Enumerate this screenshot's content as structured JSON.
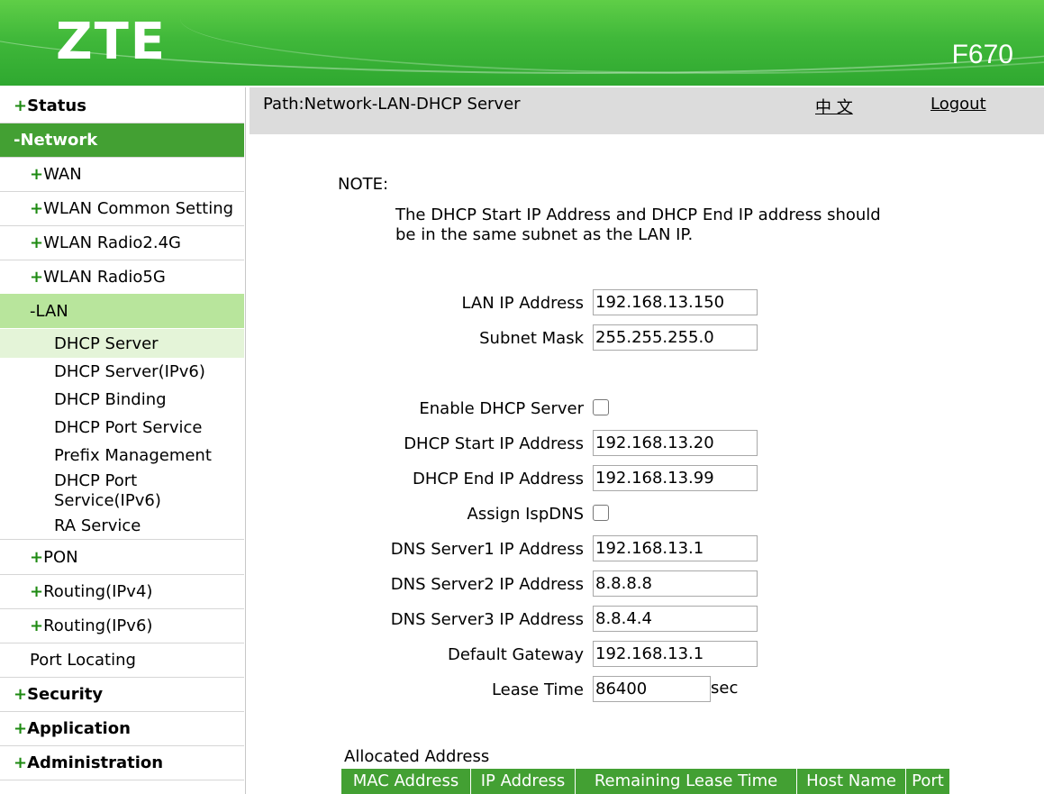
{
  "header": {
    "brand": "ZTE",
    "model": "F670"
  },
  "sidebar": {
    "status": {
      "sign": "+",
      "label": "Status"
    },
    "network": {
      "sign": "-",
      "label": "Network"
    },
    "wan": {
      "sign": "+",
      "label": "WAN"
    },
    "wlan_common": {
      "sign": "+",
      "label": "WLAN Common Setting"
    },
    "wlan_24": {
      "sign": "+",
      "label": "WLAN Radio2.4G"
    },
    "wlan_5": {
      "sign": "+",
      "label": "WLAN Radio5G"
    },
    "lan": {
      "sign": "-",
      "label": "LAN"
    },
    "lan_items": [
      "DHCP Server",
      "DHCP Server(IPv6)",
      "DHCP Binding",
      "DHCP Port Service",
      "Prefix Management",
      "DHCP Port Service(IPv6)",
      "RA Service"
    ],
    "pon": {
      "sign": "+",
      "label": "PON"
    },
    "routing4": {
      "sign": "+",
      "label": "Routing(IPv4)"
    },
    "routing6": {
      "sign": "+",
      "label": "Routing(IPv6)"
    },
    "port_locating": {
      "label": "Port Locating"
    },
    "security": {
      "sign": "+",
      "label": "Security"
    },
    "application": {
      "sign": "+",
      "label": "Application"
    },
    "administration": {
      "sign": "+",
      "label": "Administration"
    }
  },
  "pathbar": {
    "path": "Path:Network-LAN-DHCP Server",
    "language": "中 文",
    "logout": "Logout"
  },
  "note": {
    "title": "NOTE:",
    "line1": "The DHCP Start IP Address and DHCP End IP address should",
    "line2": "be in the same subnet as the LAN IP."
  },
  "form": {
    "lan_ip_label": "LAN IP Address",
    "lan_ip": "192.168.13.150",
    "subnet_label": "Subnet Mask",
    "subnet": "255.255.255.0",
    "enable_dhcp_label": "Enable DHCP Server",
    "enable_dhcp": false,
    "start_label": "DHCP Start IP Address",
    "start": "192.168.13.20",
    "end_label": "DHCP End IP Address",
    "end": "192.168.13.99",
    "isp_dns_label": "Assign IspDNS",
    "isp_dns": false,
    "dns1_label": "DNS Server1 IP Address",
    "dns1": "192.168.13.1",
    "dns2_label": "DNS Server2 IP Address",
    "dns2": "8.8.8.8",
    "dns3_label": "DNS Server3 IP Address",
    "dns3": "8.8.4.4",
    "gateway_label": "Default Gateway",
    "gateway": "192.168.13.1",
    "lease_label": "Lease Time",
    "lease": "86400",
    "lease_unit": "sec"
  },
  "allocated": {
    "title": "Allocated Address",
    "columns": [
      "MAC Address",
      "IP Address",
      "Remaining Lease Time",
      "Host Name",
      "Port"
    ]
  },
  "colors": {
    "brand_green": "#43a033",
    "lan_highlight": "#b8e59c",
    "path_bg": "#dcdcdc"
  }
}
